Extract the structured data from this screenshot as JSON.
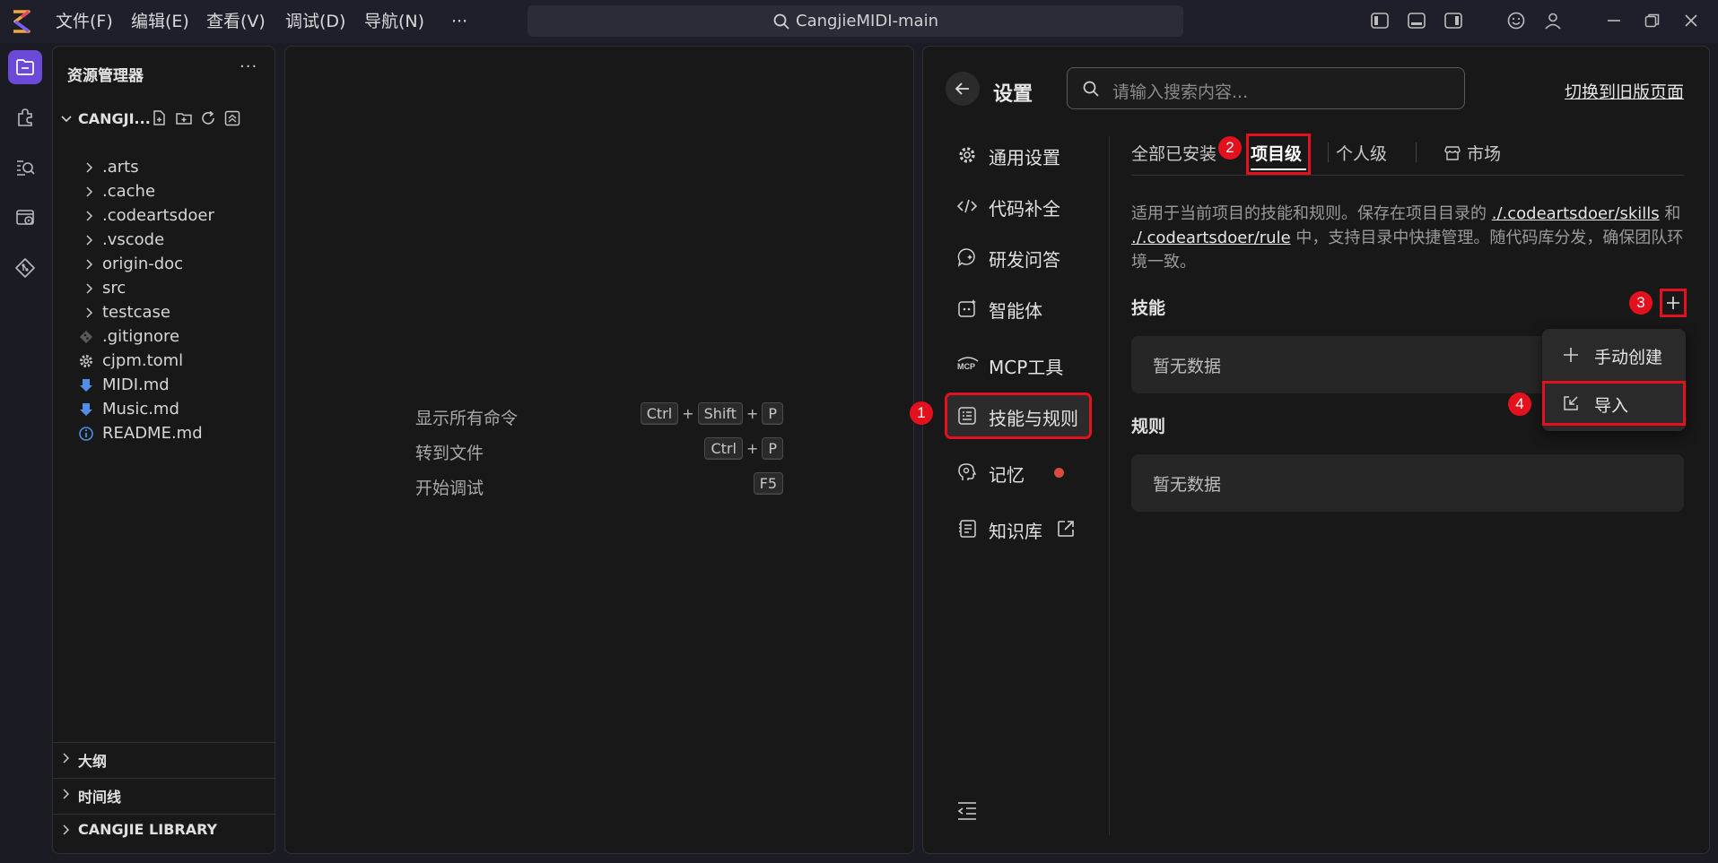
{
  "window": {
    "menus": [
      "文件(F)",
      "编辑(E)",
      "查看(V)",
      "调试(D)",
      "导航(N)",
      "···"
    ],
    "search": "CangjieMIDI-main"
  },
  "explorer": {
    "title": "资源管理器",
    "more": "···",
    "project": "CANGJI...",
    "items": [
      {
        "label": ".arts",
        "type": "folder"
      },
      {
        "label": ".cache",
        "type": "folder"
      },
      {
        "label": ".codeartsdoer",
        "type": "folder"
      },
      {
        "label": ".vscode",
        "type": "folder"
      },
      {
        "label": "origin-doc",
        "type": "folder"
      },
      {
        "label": "src",
        "type": "folder"
      },
      {
        "label": "testcase",
        "type": "folder"
      },
      {
        "label": ".gitignore",
        "type": "git"
      },
      {
        "label": "cjpm.toml",
        "type": "gear"
      },
      {
        "label": "MIDI.md",
        "type": "markdown"
      },
      {
        "label": "Music.md",
        "type": "markdown"
      },
      {
        "label": "README.md",
        "type": "info"
      }
    ],
    "sections": [
      "大纲",
      "时间线",
      "CANGJIE LIBRARY"
    ]
  },
  "editor": {
    "commands": [
      {
        "label": "显示所有命令",
        "keys": [
          "Ctrl",
          "Shift",
          "P"
        ]
      },
      {
        "label": "转到文件",
        "keys": [
          "Ctrl",
          "P"
        ]
      },
      {
        "label": "开始调试",
        "keys": [
          "F5"
        ]
      }
    ]
  },
  "settings": {
    "title": "设置",
    "search_placeholder": "请输入搜索内容...",
    "switch_old": "切换到旧版页面",
    "nav": [
      {
        "label": "通用设置",
        "icon": "gear-icon"
      },
      {
        "label": "代码补全",
        "icon": "code-icon"
      },
      {
        "label": "研发问答",
        "icon": "chat-icon"
      },
      {
        "label": "智能体",
        "icon": "agent-icon"
      },
      {
        "label": "MCP工具",
        "icon": "mcp-icon"
      },
      {
        "label": "技能与规则",
        "icon": "rules-icon"
      },
      {
        "label": "记忆",
        "icon": "memory-icon"
      },
      {
        "label": "知识库",
        "icon": "knowledge-icon"
      }
    ],
    "tabs": {
      "all": "全部已安装",
      "project": "项目级",
      "personal": "个人级",
      "market": "市场"
    },
    "description": {
      "part1": "适用于当前项目的技能和规则。保存在项目目录的 ",
      "link1": "./.codeartsdoer/skills",
      "part2": " 和 ",
      "link2": "./.codeartsdoer/rule",
      "part3": " 中，支持目录中快捷管理。随代码库分发，确保团队环境一致。"
    },
    "skills_title": "技能",
    "rules_title": "规则",
    "empty": "暂无数据",
    "dropdown": {
      "manual": "手动创建",
      "import": "导入"
    },
    "badges": [
      "1",
      "2",
      "3",
      "4"
    ]
  }
}
